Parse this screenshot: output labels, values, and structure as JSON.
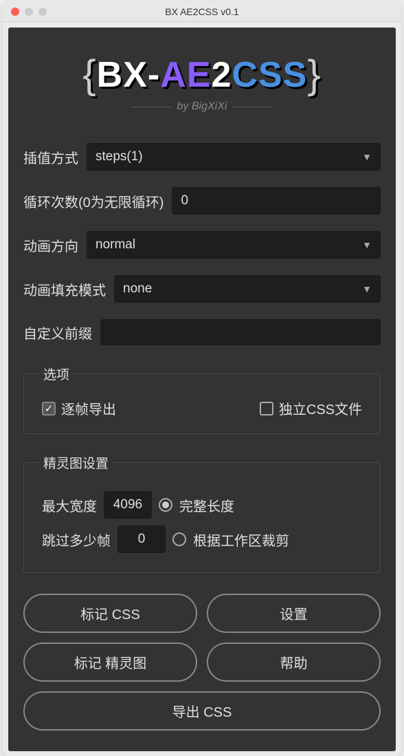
{
  "window": {
    "title": "BX AE2CSS v0.1"
  },
  "logo": {
    "brace_left": "{",
    "bx": "BX",
    "dash": "-",
    "ae": "AE",
    "two": "2",
    "css": "CSS",
    "brace_right": "}",
    "byline": "by BigXiXi"
  },
  "fields": {
    "interpolation": {
      "label": "插值方式",
      "value": "steps(1)"
    },
    "loop_count": {
      "label": "循环次数(0为无限循环)",
      "value": "0"
    },
    "direction": {
      "label": "动画方向",
      "value": "normal"
    },
    "fill_mode": {
      "label": "动画填充模式",
      "value": "none"
    },
    "custom_prefix": {
      "label": "自定义前缀",
      "value": ""
    }
  },
  "options": {
    "legend": "选项",
    "export_per_frame": {
      "label": "逐帧导出",
      "checked": true
    },
    "separate_css_file": {
      "label": "独立CSS文件",
      "checked": false
    }
  },
  "sprite": {
    "legend": "精灵图设置",
    "max_width": {
      "label": "最大宽度",
      "value": "4096"
    },
    "skip_frames": {
      "label": "跳过多少帧",
      "value": "0"
    },
    "full_length": {
      "label": "完整长度",
      "selected": true
    },
    "crop_workarea": {
      "label": "根据工作区裁剪",
      "selected": false
    }
  },
  "buttons": {
    "mark_css": "标记 CSS",
    "settings": "设置",
    "mark_sprite": "标记 精灵图",
    "help": "帮助",
    "export_css": "导出 CSS"
  }
}
